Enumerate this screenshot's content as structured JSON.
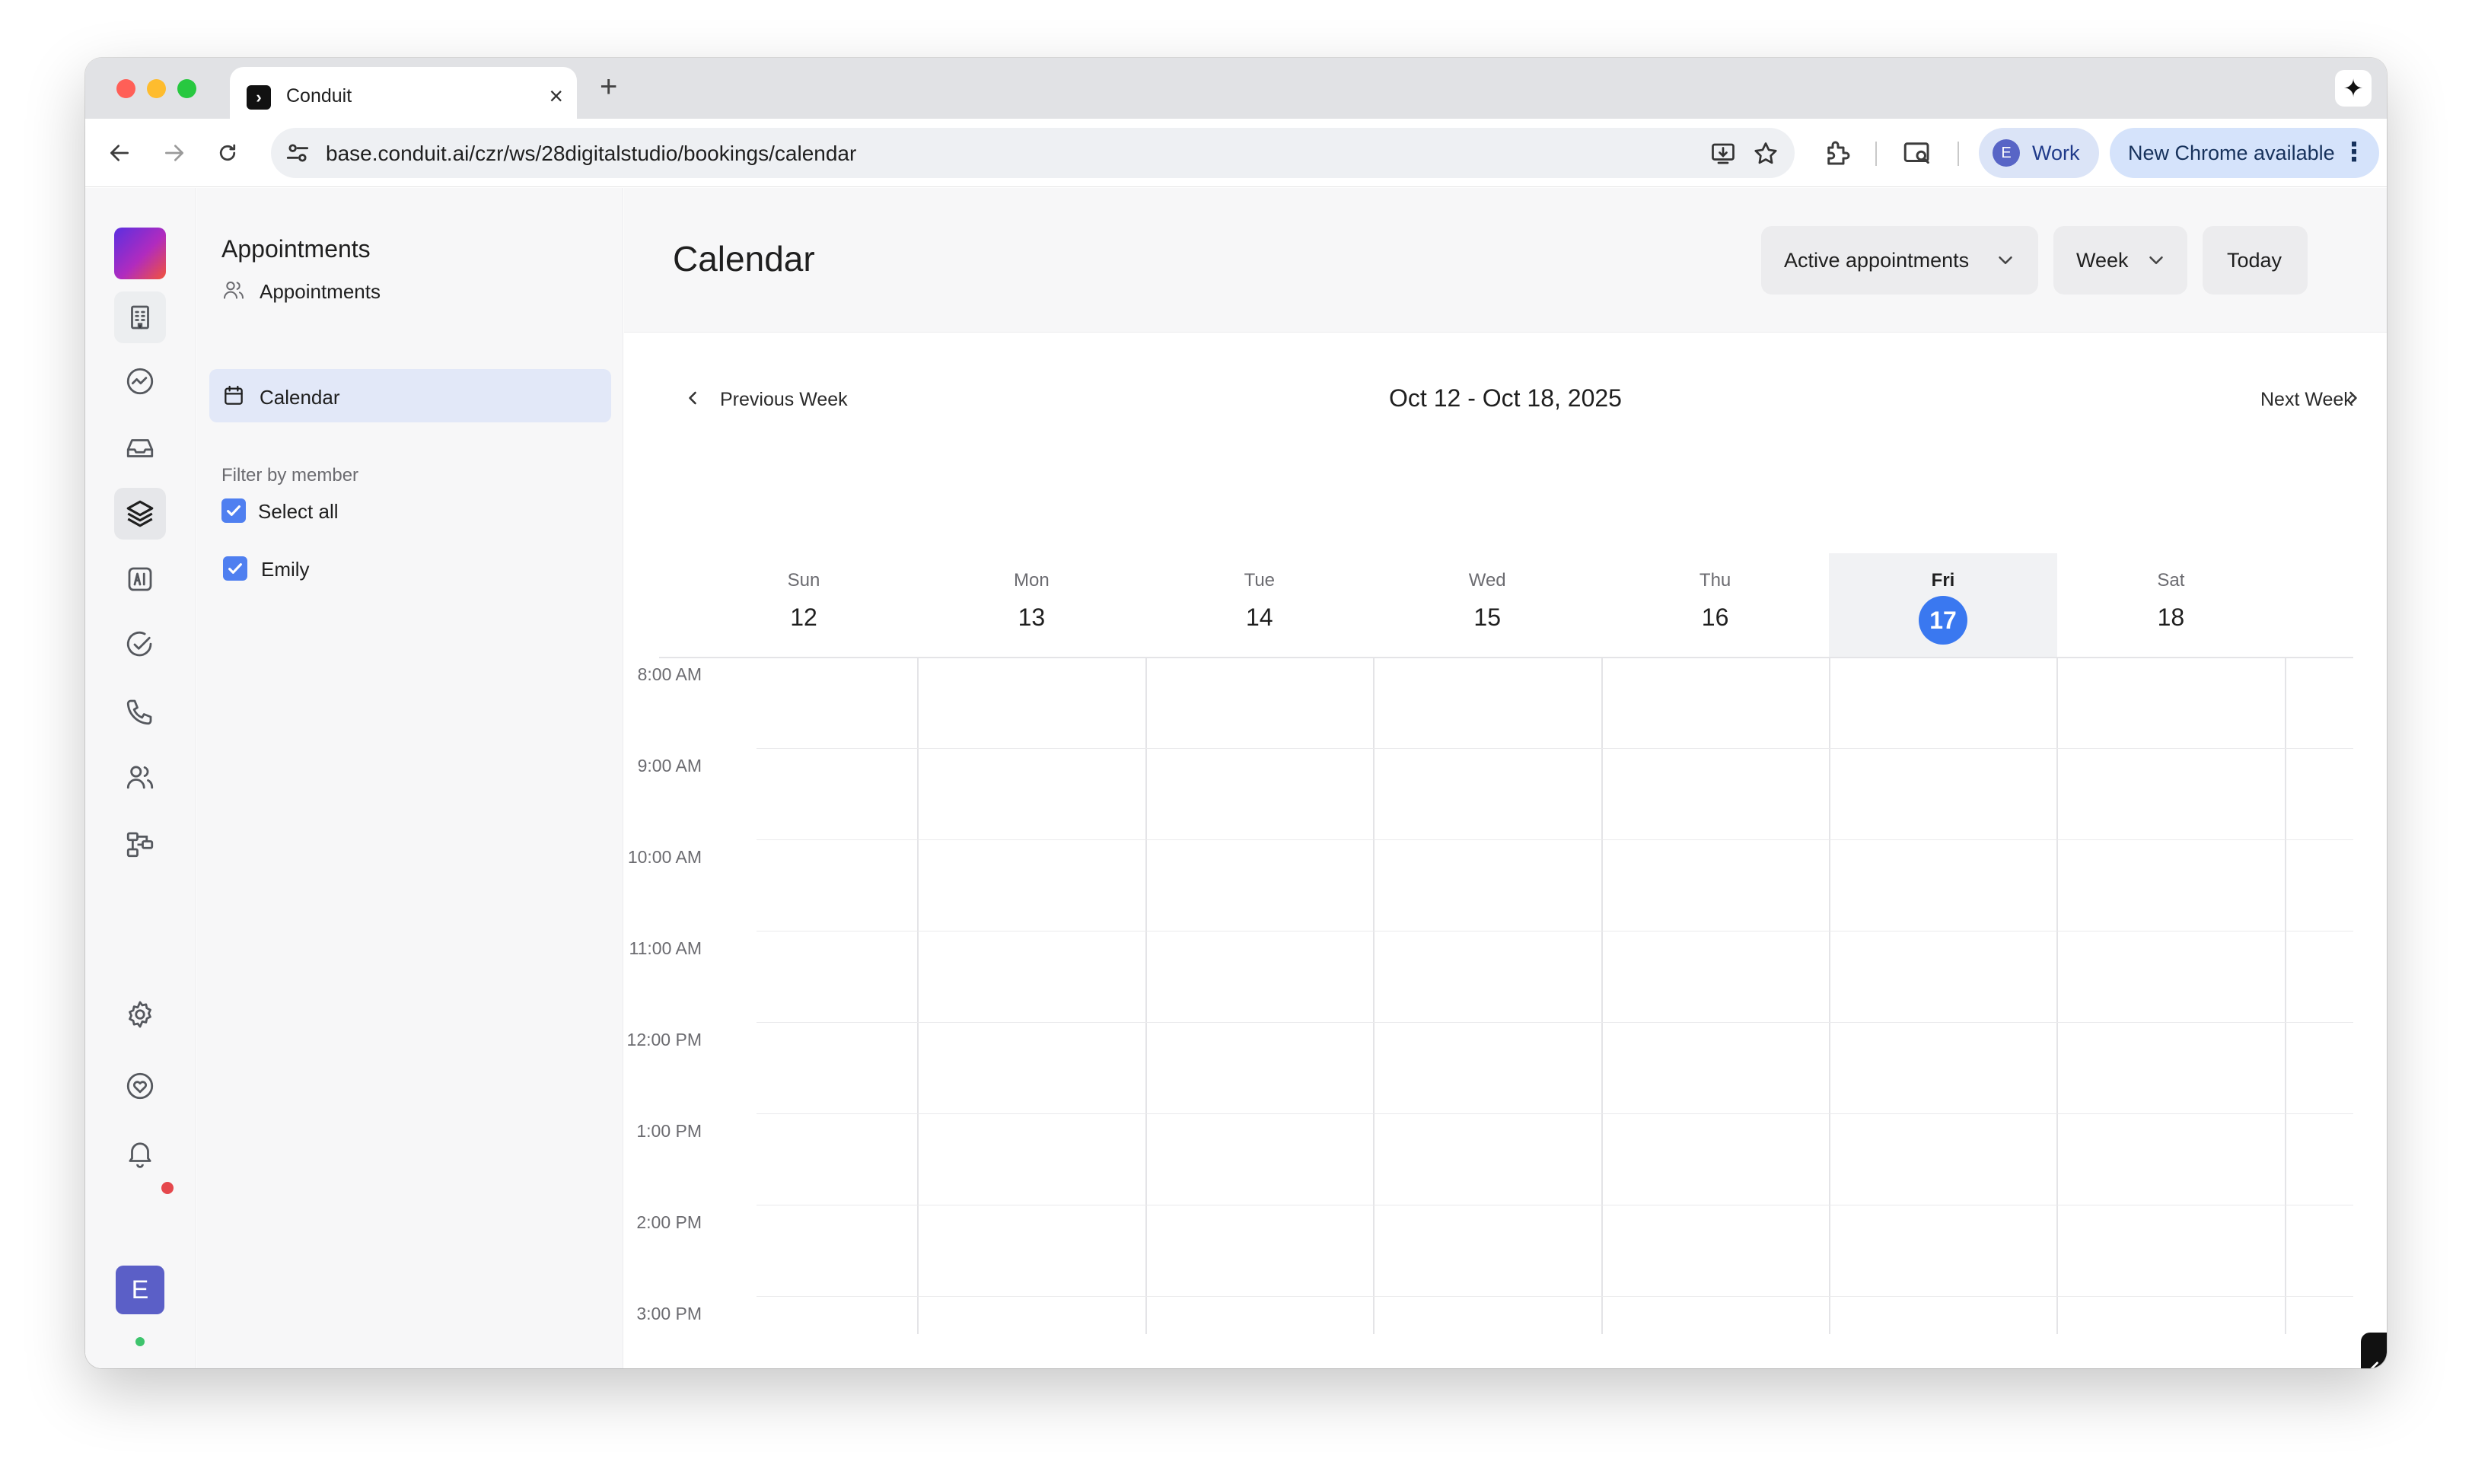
{
  "browser": {
    "tab_title": "Conduit",
    "tab_close": "×",
    "new_tab": "+",
    "url": "base.conduit.ai/czr/ws/28digitalstudio/bookings/calendar",
    "profile_initial": "E",
    "profile_label": "Work",
    "update_label": "New Chrome available",
    "update_menu": "⋮",
    "gemini_glyph": "✦"
  },
  "rail": {
    "items": [
      "building-icon",
      "activity-icon",
      "inbox-icon",
      "layers-icon",
      "ai-icon",
      "check-circle-icon",
      "phone-icon",
      "users-icon",
      "workflow-icon",
      "gear-icon",
      "heart-icon",
      "bell-icon"
    ],
    "active": "layers-icon",
    "user_initial": "E"
  },
  "sidebar": {
    "title": "Appointments",
    "items": [
      {
        "label": "Appointments",
        "icon": "users-icon"
      },
      {
        "label": "Calendar",
        "icon": "calendar-icon",
        "active": true
      }
    ],
    "filter_title": "Filter by member",
    "filters": [
      {
        "label": "Select all",
        "checked": true
      },
      {
        "label": "Emily",
        "checked": true
      }
    ]
  },
  "header": {
    "title": "Calendar",
    "filter_label": "Active appointments",
    "view_label": "Week",
    "today_label": "Today"
  },
  "weeknav": {
    "prev_label": "Previous Week",
    "range": "Oct 12 - Oct 18, 2025",
    "next_label": "Next Week"
  },
  "days": [
    {
      "name": "Sun",
      "num": "12"
    },
    {
      "name": "Mon",
      "num": "13"
    },
    {
      "name": "Tue",
      "num": "14"
    },
    {
      "name": "Wed",
      "num": "15"
    },
    {
      "name": "Thu",
      "num": "16"
    },
    {
      "name": "Fri",
      "num": "17",
      "today": true
    },
    {
      "name": "Sat",
      "num": "18"
    }
  ],
  "times": [
    "8:00 AM",
    "9:00 AM",
    "10:00 AM",
    "11:00 AM",
    "12:00 PM",
    "1:00 PM",
    "2:00 PM",
    "3:00 PM"
  ],
  "colors": {
    "accent": "#3a78f0",
    "active_nav": "#e2e8f8",
    "checkbox": "#4f7ff0"
  }
}
